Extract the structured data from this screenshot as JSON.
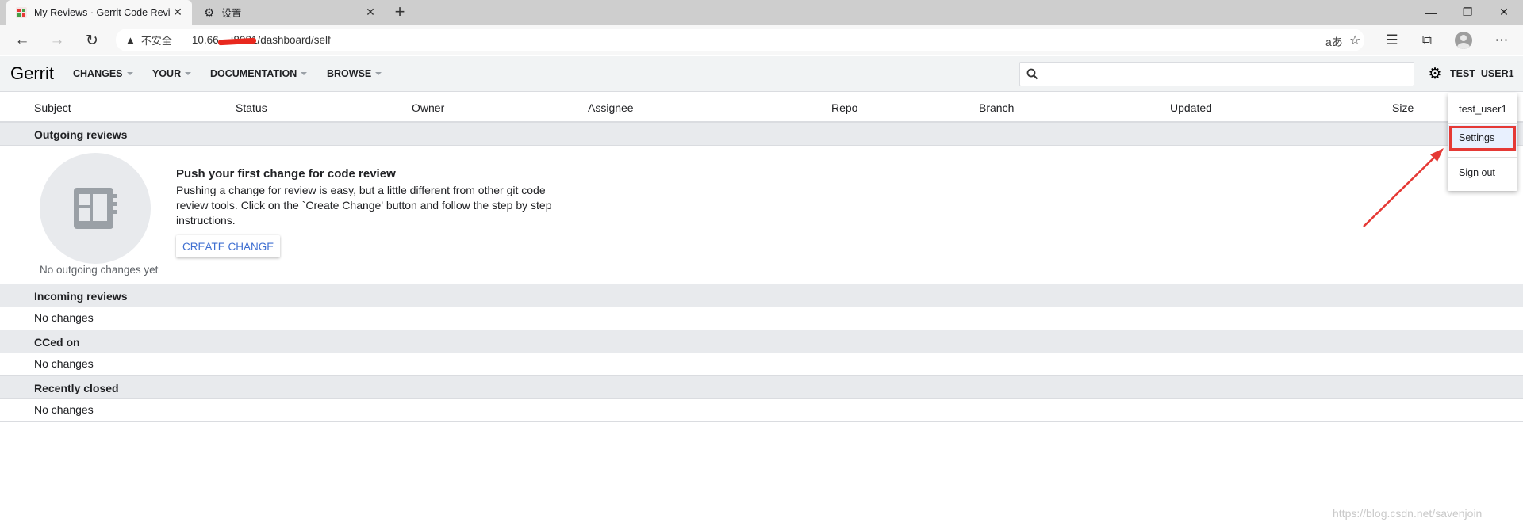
{
  "browser": {
    "tabs": [
      {
        "label": "My Reviews · Gerrit Code Review",
        "active": true
      },
      {
        "label": "设置",
        "active": false
      }
    ],
    "new_tab": "+",
    "window_controls": {
      "minimize": "—",
      "restore": "❐",
      "close": "✕"
    },
    "address": {
      "warning_label": "不安全",
      "url": "10.66.  .  :8081/dashboard/self"
    },
    "toolbar_icons": [
      "read-aloud-icon",
      "favorite-add-icon",
      "favorites-icon",
      "collections-icon",
      "profile-icon",
      "more-icon"
    ]
  },
  "header": {
    "logo": "Gerrit",
    "menus": [
      "CHANGES",
      "YOUR",
      "DOCUMENTATION",
      "BROWSE"
    ],
    "search_placeholder": "",
    "user": "TEST_USER1"
  },
  "table": {
    "columns": [
      "Subject",
      "Status",
      "Owner",
      "Assignee",
      "Repo",
      "Branch",
      "Updated",
      "Size"
    ],
    "sections": [
      {
        "title": "Outgoing reviews"
      },
      {
        "title": "Incoming reviews",
        "empty": "No changes"
      },
      {
        "title": "CCed on",
        "empty": "No changes"
      },
      {
        "title": "Recently closed",
        "empty": "No changes"
      }
    ]
  },
  "outgoing_empty": {
    "caption": "No outgoing changes yet",
    "title": "Push your first change for code review",
    "body": "Pushing a change for review is easy, but a little different from other git code review tools. Click on the `Create Change' button and follow the step by step instructions.",
    "button": "CREATE CHANGE"
  },
  "user_menu": {
    "username": "test_user1",
    "items": [
      "Settings",
      "Sign out"
    ],
    "highlight_color": "#e53935"
  },
  "watermark": "https://blog.csdn.net/savenjoin"
}
